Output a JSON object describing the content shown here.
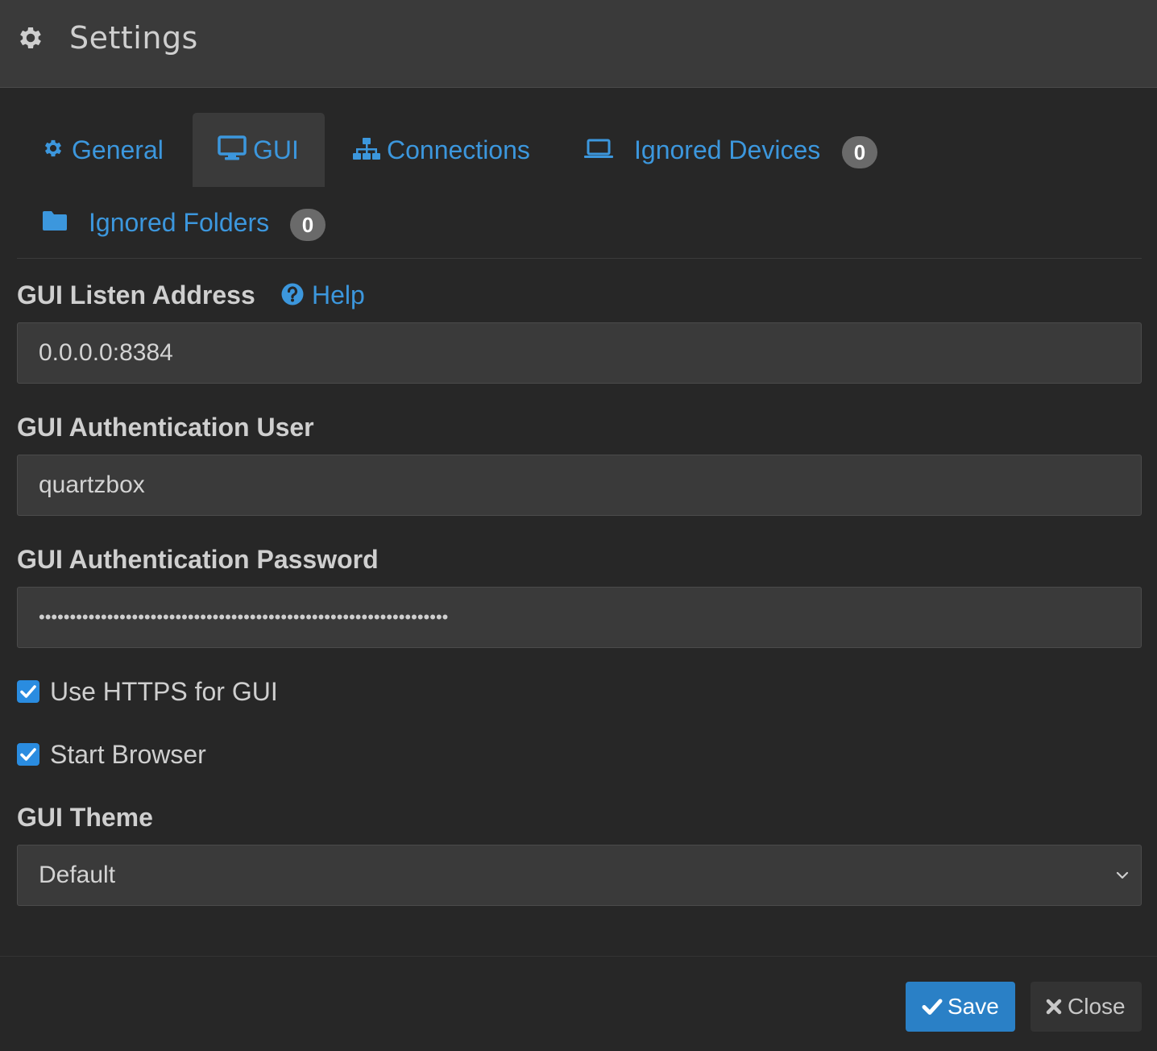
{
  "header": {
    "icon": "gear-icon",
    "title": "Settings"
  },
  "tabs": [
    {
      "label": "General",
      "icon": "gear-icon",
      "active": false
    },
    {
      "label": "GUI",
      "icon": "monitor-icon",
      "active": true
    },
    {
      "label": "Connections",
      "icon": "network-icon",
      "active": false
    },
    {
      "label": "Ignored Devices",
      "icon": "laptop-icon",
      "active": false,
      "badge": "0"
    },
    {
      "label": "Ignored Folders",
      "icon": "folder-icon",
      "active": false,
      "badge": "0"
    }
  ],
  "form": {
    "listen_address": {
      "label": "GUI Listen Address",
      "help_label": "Help",
      "value": "0.0.0.0:8384"
    },
    "auth_user": {
      "label": "GUI Authentication User",
      "value": "quartzbox"
    },
    "auth_password": {
      "label": "GUI Authentication Password",
      "value": "••••••••••••••••••••••••••••••••••••••••••••••••••••••••••••••••••"
    },
    "use_https": {
      "label": "Use HTTPS for GUI",
      "checked": true
    },
    "start_browser": {
      "label": "Start Browser",
      "checked": true
    },
    "theme": {
      "label": "GUI Theme",
      "value": "Default"
    }
  },
  "footer": {
    "save_label": "Save",
    "close_label": "Close"
  },
  "colors": {
    "accent": "#3c97dd",
    "primary_button": "#2a80c6",
    "background": "#272727",
    "panel": "#3a3a3a"
  }
}
